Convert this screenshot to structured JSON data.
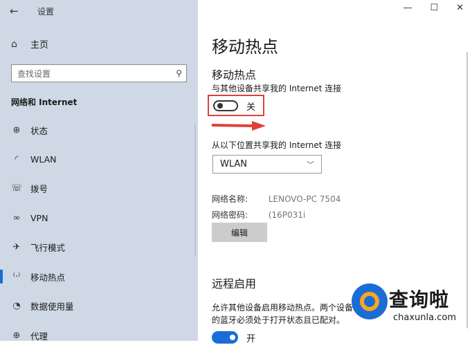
{
  "window": {
    "back_glyph": "←",
    "title": "设置",
    "minimize": "—",
    "maximize": "☐",
    "close": "✕"
  },
  "sidebar": {
    "home": {
      "icon": "⌂",
      "label": "主页"
    },
    "search": {
      "placeholder": "查找设置"
    },
    "section_title": "网络和 Internet",
    "items": [
      {
        "icon": "globe-icon",
        "glyph": "⊕",
        "label": "状态"
      },
      {
        "icon": "wifi-icon",
        "glyph": "◜",
        "label": "WLAN"
      },
      {
        "icon": "dialup-icon",
        "glyph": "☏",
        "label": "拨号"
      },
      {
        "icon": "vpn-icon",
        "glyph": "∞",
        "label": "VPN"
      },
      {
        "icon": "airplane-icon",
        "glyph": "✈",
        "label": "飞行模式"
      },
      {
        "icon": "hotspot-icon",
        "glyph": "⁽·⁾",
        "label": "移动热点"
      },
      {
        "icon": "data-usage-icon",
        "glyph": "◔",
        "label": "数据使用量"
      },
      {
        "icon": "proxy-icon",
        "glyph": "⊕",
        "label": "代理"
      }
    ]
  },
  "main": {
    "page_title": "移动热点",
    "sub_title": "移动热点",
    "share_label": "与其他设备共享我的 Internet 连接",
    "toggle_state": "关",
    "from_label": "从以下位置共享我的 Internet 连接",
    "select_value": "WLAN",
    "network_name_label": "网络名称:",
    "network_name_value": "LENOVO-PC 7504",
    "network_password_label": "网络密码:",
    "network_password_value": "(16P031i",
    "edit_button": "编辑",
    "remote_title": "远程启用",
    "remote_desc": "允许其他设备启用移动热点。两个设备的蓝牙必须处于打开状态且已配对。",
    "remote_toggle_state": "开"
  },
  "watermark": {
    "cn": "查询啦",
    "en": "chaxunla.com"
  },
  "colors": {
    "sidebar_bg": "#cfd9e6",
    "accent": "#1a6dd6",
    "highlight": "#e0403a"
  }
}
